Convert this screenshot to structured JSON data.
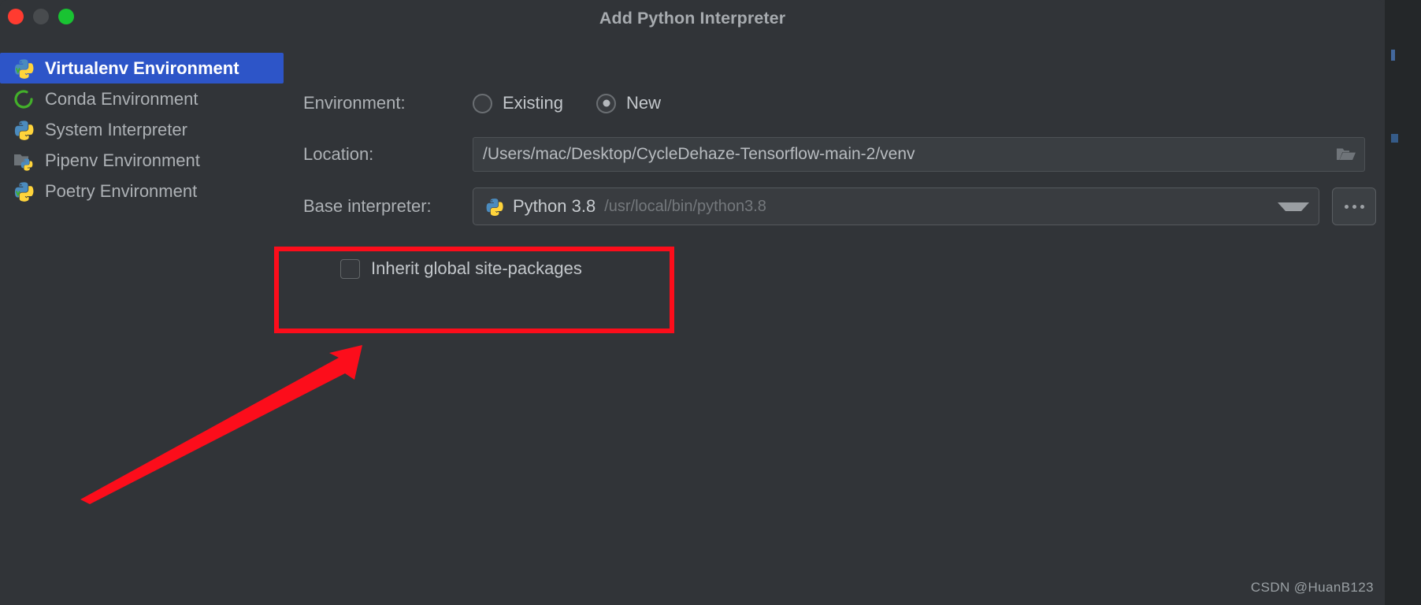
{
  "window": {
    "title": "Add Python Interpreter",
    "controls": {
      "close": "close-button",
      "minimize": "minimize-button",
      "zoom": "zoom-button"
    },
    "accent_selected": "#2d55c8",
    "background": "#313438",
    "annotation_color": "#fc0d1b"
  },
  "sidebar": {
    "items": [
      {
        "label": "Virtualenv Environment",
        "icon": "python-venv-icon",
        "selected": true
      },
      {
        "label": "Conda Environment",
        "icon": "conda-icon",
        "selected": false
      },
      {
        "label": "System Interpreter",
        "icon": "python-icon",
        "selected": false
      },
      {
        "label": "Pipenv Environment",
        "icon": "pipenv-folder-python-icon",
        "selected": false
      },
      {
        "label": "Poetry Environment",
        "icon": "poetry-python-icon",
        "selected": false
      }
    ]
  },
  "form": {
    "environment": {
      "label": "Environment:",
      "options": [
        {
          "label": "Existing",
          "selected": false
        },
        {
          "label": "New",
          "selected": true
        }
      ]
    },
    "location": {
      "label": "Location:",
      "value": "/Users/mac/Desktop/CycleDehaze-Tensorflow-main-2/venv",
      "browse_icon": "folder-icon"
    },
    "base_interpreter": {
      "label": "Base interpreter:",
      "icon": "python-icon",
      "value": "Python 3.8",
      "path": "/usr/local/bin/python3.8",
      "dropdown_icon": "chevron-down-icon",
      "more_button": "..."
    },
    "inherit_site_packages": {
      "label": "Inherit global site-packages",
      "checked": false
    }
  },
  "annotations": {
    "highlight_rect": "red-rectangle-around-inherit-global-site-packages",
    "arrow": "red-arrow-pointing-to-inherit-global-site-packages"
  },
  "watermark": {
    "text": "CSDN @HuanB123"
  }
}
